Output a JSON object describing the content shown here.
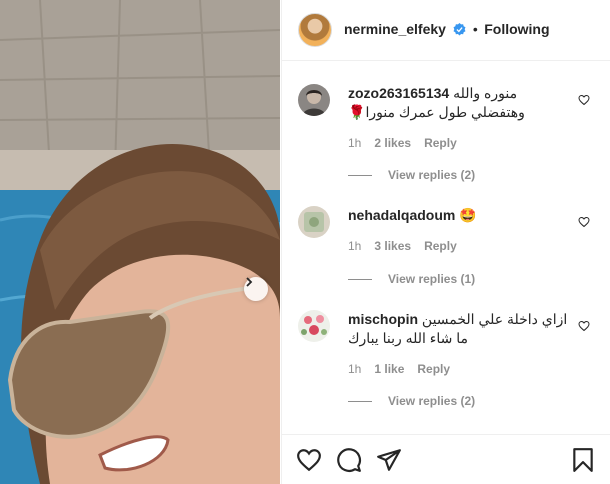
{
  "post": {
    "author": "nermine_elfeky",
    "separator": "•",
    "follow_status": "Following"
  },
  "comments": [
    {
      "user": "zozo263165134",
      "text_line1": "منوره والله",
      "text_line2": "وهتفضلي طول عمرك منورا",
      "time": "1h",
      "likes": "2 likes",
      "reply": "Reply",
      "view_replies": "View replies (2)",
      "emoji": "🌹"
    },
    {
      "user": "nehadalqadoum",
      "text_line1": "",
      "time": "1h",
      "likes": "3 likes",
      "reply": "Reply",
      "view_replies": "View replies (1)",
      "emoji": "🤩"
    },
    {
      "user": "mischopin",
      "text_line1": "ازاي داخلة علي الخمسين",
      "text_line2": "ما شاء الله ربنا يبارك",
      "time": "1h",
      "likes": "1 like",
      "reply": "Reply",
      "view_replies": "View replies (2)"
    }
  ],
  "icons": {
    "verified": "verified-badge-icon",
    "next": "chevron-right-icon",
    "like": "heart-icon",
    "comment": "comment-icon",
    "share": "share-icon",
    "save": "bookmark-icon"
  },
  "colors": {
    "verified": "#3897f0",
    "text": "#262626",
    "muted": "#8e8e8e",
    "border": "#efefef"
  }
}
